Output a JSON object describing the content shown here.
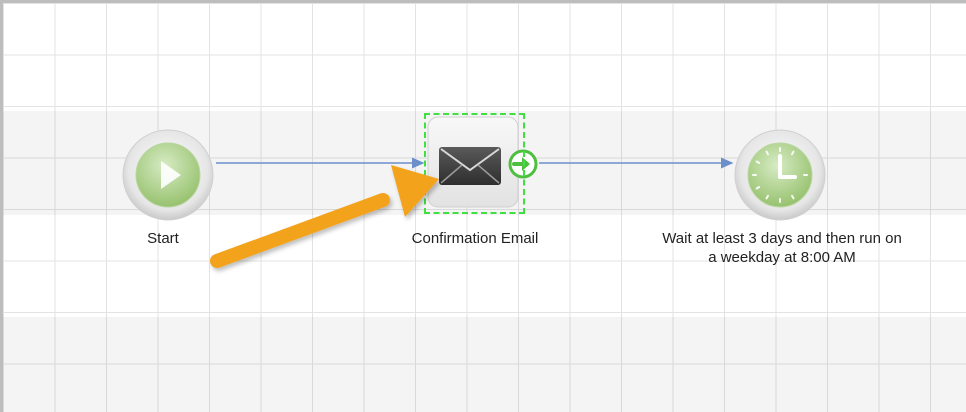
{
  "workflow": {
    "nodes": [
      {
        "label": "Start",
        "icon": "play-icon"
      },
      {
        "label": "Confirmation Email",
        "icon": "envelope-icon"
      },
      {
        "label": "Wait at least 3 days and then run on a weekday at 8:00 AM",
        "icon": "clock-icon"
      }
    ],
    "selected_node_index": 1
  },
  "colors": {
    "connector": "#6b8fc9",
    "selection": "#3fe03f",
    "callout_arrow": "#f3a21d",
    "node_green": "#a9cf8a"
  }
}
